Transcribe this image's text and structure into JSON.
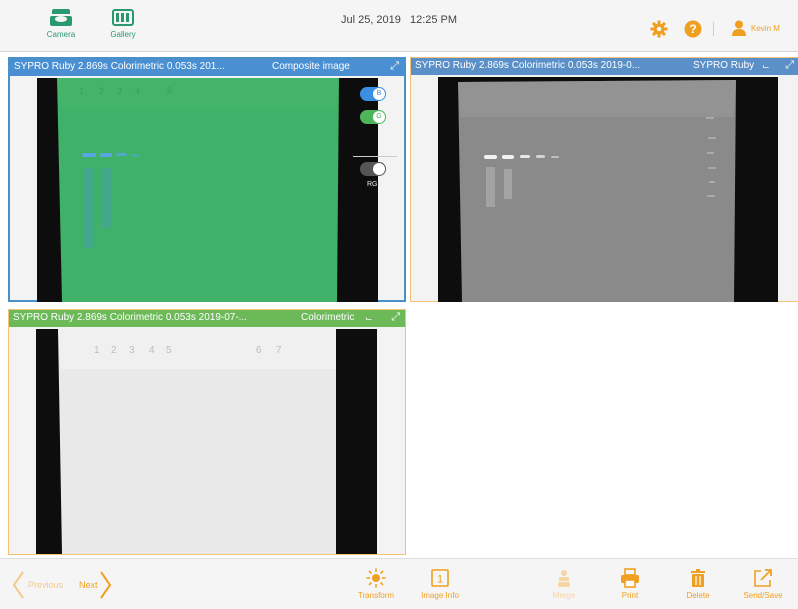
{
  "header": {
    "nav": [
      {
        "label": "Camera",
        "icon": "camera-icon"
      },
      {
        "label": "Gallery",
        "icon": "gallery-icon"
      }
    ],
    "date": "Jul 25, 2019",
    "time": "12:25 PM",
    "user_name": "Kevin M",
    "icons": [
      "settings-icon",
      "help-icon",
      "user-icon"
    ]
  },
  "panels": [
    {
      "title": "SYPRO Ruby 2.869s Colorimetric 0.053s 201...",
      "mode": "Composite image",
      "border_color": "#4a90c8",
      "toggles": [
        {
          "label": "B",
          "on": true,
          "color": "#3b8fe0"
        },
        {
          "label": "G",
          "on": true,
          "color": "#4eb55a"
        },
        {
          "label": "RGB",
          "on": true,
          "color": "#555555"
        }
      ]
    },
    {
      "title": "SYPRO Ruby 2.869s Colorimetric 0.053s 2019-0...",
      "mode": "SYPRO Ruby",
      "border_color": "#f2c277"
    },
    {
      "title": "SYPRO Ruby 2.869s Colorimetric 0.053s 2019-07-...",
      "mode": "Colorimetric",
      "border_color": "#f2c277"
    }
  ],
  "footer": {
    "previous": "Previous",
    "next": "Next",
    "tools": [
      {
        "label": "Transform",
        "icon": "sun-icon",
        "enabled": true
      },
      {
        "label": "Image Info",
        "icon": "info-icon",
        "enabled": true
      },
      {
        "label": "Merge",
        "icon": "merge-icon",
        "enabled": false
      },
      {
        "label": "Print",
        "icon": "print-icon",
        "enabled": true
      },
      {
        "label": "Delete",
        "icon": "trash-icon",
        "enabled": true
      },
      {
        "label": "Send/Save",
        "icon": "share-icon",
        "enabled": true
      }
    ]
  },
  "colors": {
    "accent": "#f0a020",
    "brand_green": "#2a9a6e",
    "blue_header": "#4a8fd2",
    "green_header": "#6cb958"
  }
}
